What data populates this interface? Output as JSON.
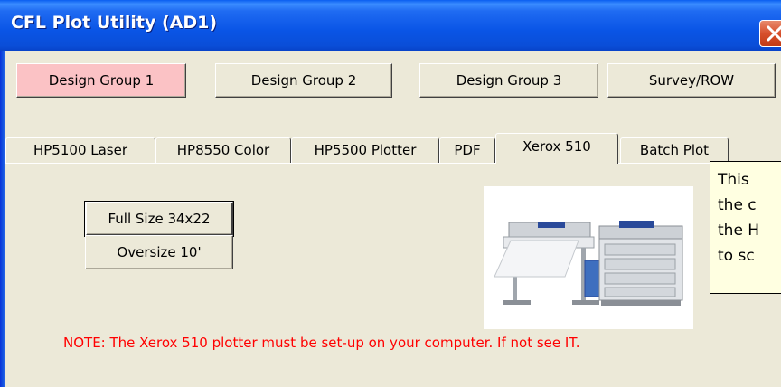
{
  "window": {
    "title": "CFL Plot Utility (AD1)"
  },
  "design_groups": [
    {
      "label": "Design Group 1",
      "active": true
    },
    {
      "label": "Design Group 2",
      "active": false
    },
    {
      "label": "Design Group 3",
      "active": false
    },
    {
      "label": "Survey/ROW",
      "active": false
    }
  ],
  "tabs": [
    {
      "label": "HP5100 Laser"
    },
    {
      "label": "HP8550 Color"
    },
    {
      "label": "HP5500 Plotter"
    },
    {
      "label": "PDF"
    },
    {
      "label": "Xerox 510",
      "selected": true
    },
    {
      "label": "Batch Plot"
    }
  ],
  "panel": {
    "buttons": [
      {
        "label": "Full Size 34x22"
      },
      {
        "label": "Oversize 10'"
      }
    ],
    "note": "NOTE: The Xerox 510 plotter must be set-up on your computer. If not see IT."
  },
  "tooltip": {
    "lines": [
      "This",
      "the c",
      "the H",
      "to sc"
    ]
  },
  "colors": {
    "active_group": "#fbc2c5",
    "note_text": "#ff0000",
    "tooltip_bg": "#ffffe1",
    "titlebar": "#0a55e6"
  }
}
